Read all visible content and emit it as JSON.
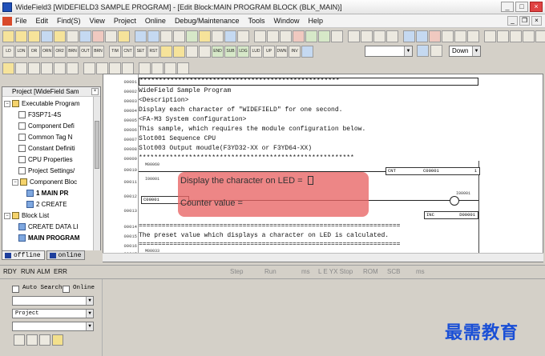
{
  "window": {
    "title": "WideField3 [WIDEFIELD3 SAMPLE PROGRAM] - [Edit Block:MAIN PROGRAM BLOCK (BLK_MAIN)]"
  },
  "menu": [
    "File",
    "Edit",
    "Find(S)",
    "View",
    "Project",
    "Online",
    "Debug/Maintenance",
    "Tools",
    "Window",
    "Help"
  ],
  "toolbar2_labels": [
    "LD",
    "LDN",
    "OR",
    "ORN",
    "OR2",
    "BRN",
    "OUT",
    "BRN",
    "TIM",
    "CNT",
    "SET",
    "RST",
    "END",
    "SUB",
    "LDG",
    "LUD",
    "UP",
    "DWN",
    "INV"
  ],
  "toolbar2": {
    "select_value": "",
    "down_select": "Down"
  },
  "project": {
    "title": "Project [WideField Sam",
    "tree": [
      "Executable Program",
      "F3SP71-4S",
      "Component Defi",
      "Common Tag N",
      "Constant Definiti",
      "CPU Properties",
      "Project Settings/",
      "Component Bloc",
      "1 MAIN PR",
      "2 CREATE",
      "Block List",
      "CREATE DATA LI",
      "MAIN PROGRAM"
    ],
    "tabs": [
      "offline",
      "online"
    ]
  },
  "editor": {
    "line_numbers": [
      "00001",
      "00002",
      "00003",
      "00004",
      "00005",
      "00006",
      "00007",
      "00008",
      "00009",
      "00010",
      "00011",
      "00012",
      "00013",
      "00014",
      "00015",
      "00016",
      "00017"
    ],
    "lines": [
      "WideField Sample Program",
      "<Description>",
      "Display each character of \"WIDEFIELD\" for one second.",
      "<FA-M3 System configuration>",
      "This sample, which requires the module configuration below.",
      "  Slot001 Sequence CPU",
      "  Slot003 Output moudle(F3YD32-XX or F3YD64-XX)",
      "The preset value which displays a character on LED is calculated."
    ],
    "rule_row1": "****************************************************",
    "rule_row8": "********************************************************",
    "rule_row14": "====================================================================",
    "rule_row16": "====================================================================",
    "devices": {
      "m60": "M00060",
      "i1": "I00001",
      "cnt": "CNT",
      "c1": "C00001",
      "c1b": "C00001",
      "i1b": "I00001",
      "inc": "INC",
      "d1": "D00001",
      "m33": "M00033",
      "one": "1"
    },
    "overlay": {
      "line1": "Display the character on LED = ",
      "line2": "Counter value = "
    }
  },
  "status": {
    "items": [
      "RDY",
      "RUN",
      "ALM",
      "ERR"
    ],
    "dim_items": [
      "Step",
      "Run",
      "ms",
      "L E YX Stop",
      "ROM",
      "SCB",
      "ms"
    ]
  },
  "find": {
    "auto_search": "Auto Search",
    "online": "Online",
    "project_label": "Project",
    "combo_top": "",
    "combo_bottom": ""
  },
  "watermark": "最需教育"
}
